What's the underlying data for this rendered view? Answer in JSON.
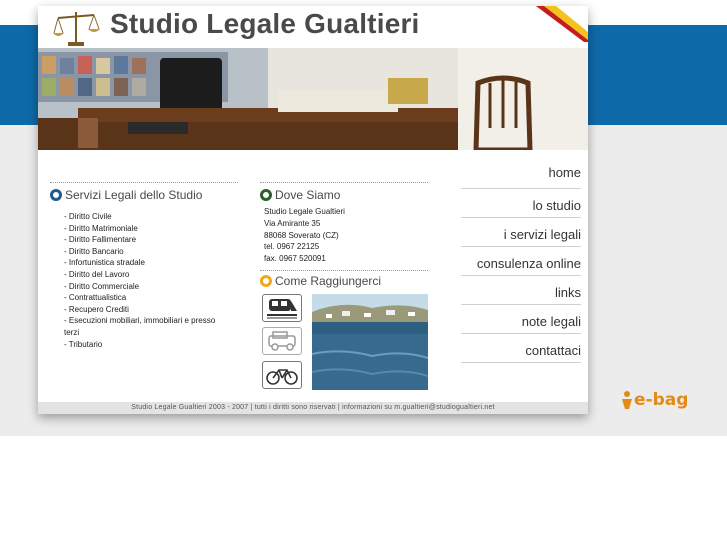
{
  "header": {
    "title": "Studio Legale Gualtieri"
  },
  "services": {
    "heading": "Servizi Legali dello Studio",
    "items": [
      "- Diritto Civile",
      "- Diritto Matrimoniale",
      "- Diritto Fallimentare",
      "- Diritto Bancario",
      "- Infortunistica stradale",
      "- Diritto del Lavoro",
      "- Diritto Commerciale",
      "- Contrattualistica",
      "- Recupero Crediti",
      "- Esecuzioni mobiliari, immobiliari e presso terzi",
      "- Tributario"
    ]
  },
  "location": {
    "heading": "Dove Siamo",
    "lines": [
      "Studio Legale Gualtieri",
      "Via Amirante 35",
      "88068 Soverato (CZ)",
      "tel. 0967 22125",
      "fax. 0967 520091"
    ]
  },
  "directions": {
    "heading": "Come Raggiungerci",
    "icons": [
      "train-icon",
      "car-icon",
      "bicycle-icon"
    ]
  },
  "nav": {
    "items": [
      "home",
      "lo studio",
      "i servizi legali",
      "consulenza online",
      "links",
      "note legali",
      "contattaci"
    ]
  },
  "footer": {
    "text": "Studio Legale Gualtieri 2003 - 2007 | tutti i diritti sono riservati | informazioni su m.gualtieri@studiogualtieri.net"
  },
  "badge": {
    "text": "e-bag"
  },
  "colors": {
    "band_blue": "#0e6aa8",
    "bullet_blue": "#1f5b8f",
    "bullet_green": "#2f5e2a",
    "bullet_orange": "#f1a91c",
    "ebag_orange": "#e38b16"
  }
}
